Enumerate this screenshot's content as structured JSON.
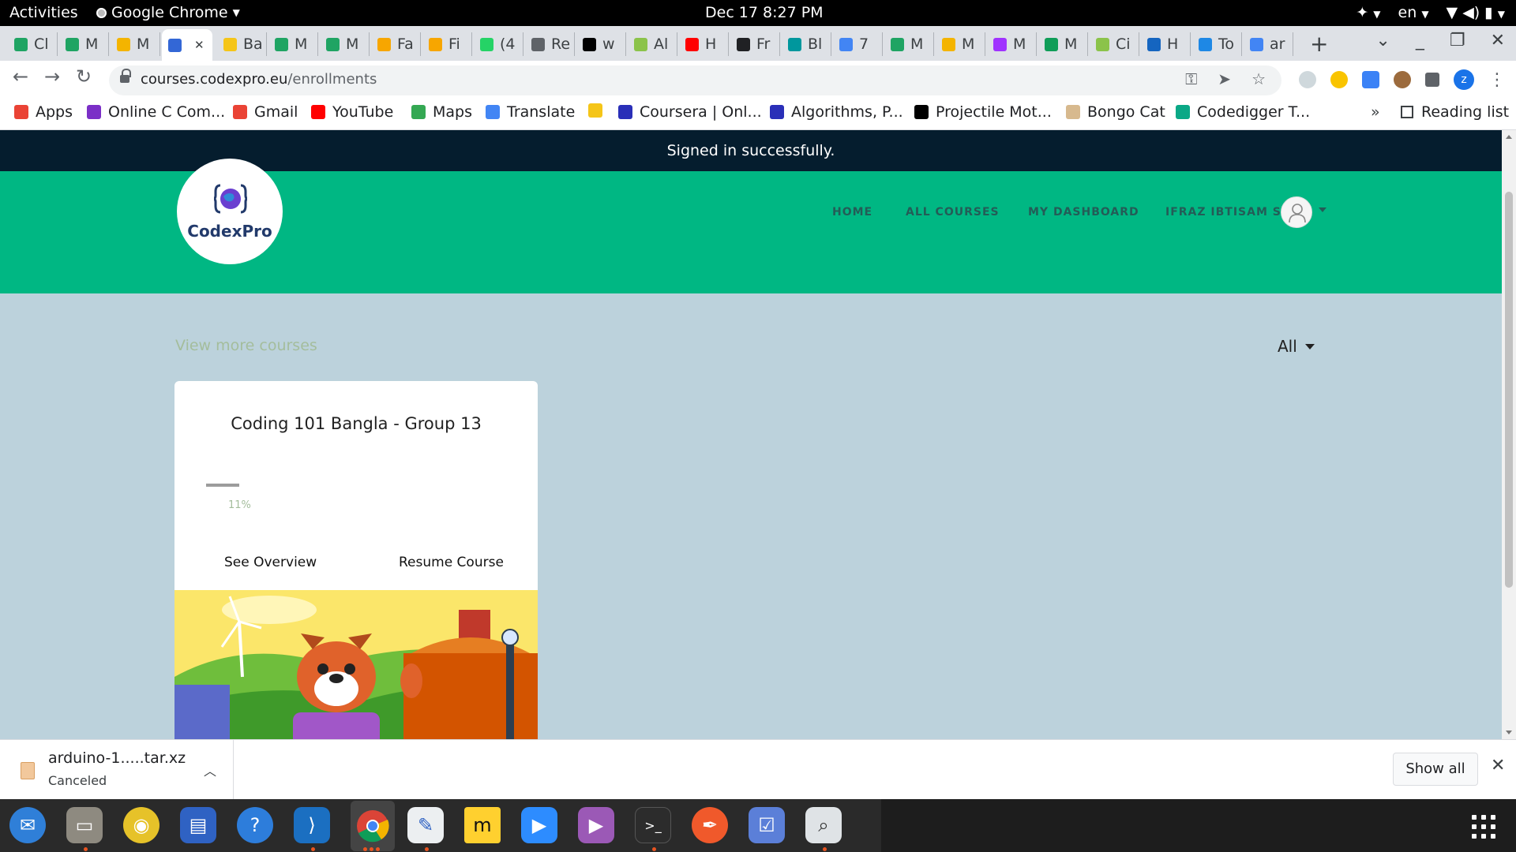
{
  "topbar": {
    "activities": "Activities",
    "app_name": "Google Chrome",
    "clock": "Dec 17  8:27 PM",
    "lang": "en"
  },
  "tabs": [
    {
      "label": "Cl",
      "color": "#1fa463"
    },
    {
      "label": "M",
      "color": "#1fa463"
    },
    {
      "label": "M",
      "color": "#f4b400"
    },
    {
      "label": "",
      "color": "#3367d6",
      "active": true
    },
    {
      "label": "Ba",
      "color": "#f5c518"
    },
    {
      "label": "M",
      "color": "#1fa463"
    },
    {
      "label": "M",
      "color": "#1fa463"
    },
    {
      "label": "Fa",
      "color": "#f7a600"
    },
    {
      "label": "Fi",
      "color": "#f7a600"
    },
    {
      "label": "(4",
      "color": "#25d366"
    },
    {
      "label": "Re",
      "color": "#5f6368"
    },
    {
      "label": "w",
      "color": "#000000"
    },
    {
      "label": "Al",
      "color": "#8bc34a"
    },
    {
      "label": "H",
      "color": "#ff0000"
    },
    {
      "label": "Fr",
      "color": "#202124"
    },
    {
      "label": "Bl",
      "color": "#00979d"
    },
    {
      "label": "7",
      "color": "#4285f4"
    },
    {
      "label": "M",
      "color": "#1fa463"
    },
    {
      "label": "M",
      "color": "#f4b400"
    },
    {
      "label": "M",
      "color": "#a033ff"
    },
    {
      "label": "M",
      "color": "#0f9d58"
    },
    {
      "label": "Ci",
      "color": "#8bc34a"
    },
    {
      "label": "H",
      "color": "#1565c0"
    },
    {
      "label": "To",
      "color": "#1e88e5"
    },
    {
      "label": "ar",
      "color": "#4285f4"
    }
  ],
  "url": {
    "host": "courses.codexpro.eu",
    "path": "/enrollments"
  },
  "profile_initial": "z",
  "bookmarks": [
    {
      "label": "Apps",
      "color": "#ea4335"
    },
    {
      "label": "Online C Com...",
      "color": "#7b2fc7"
    },
    {
      "label": "Gmail",
      "color": "#ea4335"
    },
    {
      "label": "YouTube",
      "color": "#ff0000"
    },
    {
      "label": "Maps",
      "color": "#34a853"
    },
    {
      "label": "Translate",
      "color": "#4285f4"
    },
    {
      "label": "",
      "color": "#f5c518"
    },
    {
      "label": "Coursera | Onl...",
      "color": "#2a2fb8"
    },
    {
      "label": "Algorithms, P...",
      "color": "#2a2fb8"
    },
    {
      "label": "Projectile Mot...",
      "color": "#000000"
    },
    {
      "label": "Bongo Cat",
      "color": "#d7b98e"
    },
    {
      "label": "Codedigger T...",
      "color": "#0aa886"
    }
  ],
  "bookmarks_more": "»",
  "reading_list": "Reading list",
  "page": {
    "flash": "Signed in successfully.",
    "brand": "CodexPro",
    "nav": [
      "HOME",
      "ALL COURSES",
      "MY DASHBOARD",
      "IFRAZ IBTISAM S"
    ],
    "view_more": "View more courses",
    "filter": "All",
    "course": {
      "title": "Coding 101 Bangla - Group 13",
      "progress_pct": 11,
      "progress_label": "11%",
      "overview": "See Overview",
      "resume": "Resume Course"
    }
  },
  "download": {
    "name": "arduino-1.....tar.xz",
    "status": "Canceled",
    "show_all": "Show all"
  },
  "colors": {
    "header_green": "#00b783",
    "flash_bg": "#051d2e",
    "page_bg": "#bcd2dc"
  }
}
